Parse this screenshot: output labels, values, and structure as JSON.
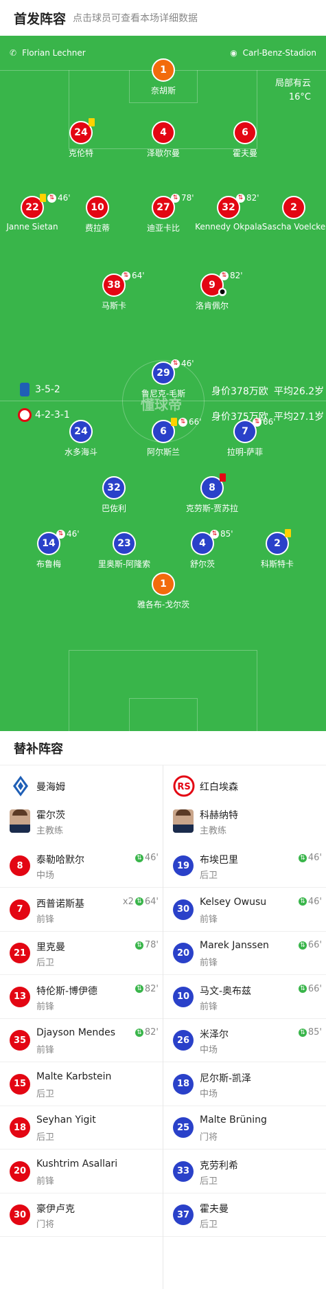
{
  "header": {
    "title": "首发阵容",
    "subtitle": "点击球员可查看本场详细数据"
  },
  "match_info": {
    "referee": "Florian Lechner",
    "stadium": "Carl-Benz-Stadion",
    "weather": "局部有云",
    "temperature": "16°C"
  },
  "watermark": "懂球帝",
  "teams": {
    "home": {
      "formation": "3-5-2",
      "value": "身价378万欧",
      "avg_age": "平均26.2岁"
    },
    "away": {
      "formation": "4-2-3-1",
      "value": "身价375万欧",
      "avg_age": "平均27.1岁"
    }
  },
  "home_lineup": [
    {
      "num": "1",
      "name": "奈胡斯",
      "pos": "gk",
      "ev": ""
    },
    {
      "num": "24",
      "name": "克伦特",
      "ev": "",
      "yellow": true
    },
    {
      "num": "4",
      "name": "泽歇尔曼",
      "ev": ""
    },
    {
      "num": "6",
      "name": "霍夫曼",
      "ev": ""
    },
    {
      "num": "22",
      "name": "Janne Sietan",
      "ev": "46'",
      "yellow": true,
      "sub": true
    },
    {
      "num": "10",
      "name": "费拉蒂",
      "ev": ""
    },
    {
      "num": "27",
      "name": "迪亚卡比",
      "ev": "78'",
      "sub": true
    },
    {
      "num": "32",
      "name": "Kennedy Okpala",
      "ev": "82'",
      "sub": true
    },
    {
      "num": "2",
      "name": "Sascha Voelcke",
      "ev": ""
    },
    {
      "num": "38",
      "name": "马斯卡",
      "ev": "64'",
      "sub": true
    },
    {
      "num": "9",
      "name": "洛肯佩尔",
      "ev": "82'",
      "sub": true,
      "goal": true
    }
  ],
  "away_lineup": [
    {
      "num": "29",
      "name": "鲁尼克-毛斯",
      "ev": "46'",
      "sub": true
    },
    {
      "num": "24",
      "name": "水多海斗",
      "ev": ""
    },
    {
      "num": "6",
      "name": "阿尔斯兰",
      "ev": "66'",
      "yellow": true,
      "sub": true
    },
    {
      "num": "7",
      "name": "拉明-萨菲",
      "ev": "66'",
      "sub": true
    },
    {
      "num": "32",
      "name": "巴佐利",
      "ev": ""
    },
    {
      "num": "8",
      "name": "克劳斯-贾苏拉",
      "ev": "",
      "red": true
    },
    {
      "num": "14",
      "name": "布鲁梅",
      "ev": "46'",
      "sub": true
    },
    {
      "num": "23",
      "name": "里奥斯-阿隆索",
      "ev": ""
    },
    {
      "num": "4",
      "name": "舒尔茨",
      "ev": "85'",
      "sub": true
    },
    {
      "num": "2",
      "name": "科斯特卡",
      "ev": "",
      "yellow": true
    },
    {
      "num": "1",
      "name": "雅各布-戈尔茨",
      "pos": "gk",
      "ev": ""
    }
  ],
  "subs_title": "替补阵容",
  "home_team": {
    "name": "曼海姆",
    "coach": "霍尔茨",
    "coach_role": "主教练"
  },
  "away_team": {
    "name": "红白埃森",
    "coach": "科赫纳特",
    "coach_role": "主教练"
  },
  "home_subs": [
    {
      "num": "8",
      "name": "泰勒哈默尔",
      "pos": "中场",
      "ev": "46'"
    },
    {
      "num": "7",
      "name": "西普诺斯基",
      "pos": "前锋",
      "ev": "64'",
      "extra": "x2"
    },
    {
      "num": "21",
      "name": "里克曼",
      "pos": "后卫",
      "ev": "78'"
    },
    {
      "num": "13",
      "name": "特伦斯-博伊德",
      "pos": "前锋",
      "ev": "82'"
    },
    {
      "num": "35",
      "name": "Djayson Mendes",
      "pos": "前锋",
      "ev": "82'"
    },
    {
      "num": "15",
      "name": "Malte Karbstein",
      "pos": "后卫",
      "ev": ""
    },
    {
      "num": "18",
      "name": "Seyhan Yigit",
      "pos": "后卫",
      "ev": ""
    },
    {
      "num": "20",
      "name": "Kushtrim Asallari",
      "pos": "前锋",
      "ev": ""
    },
    {
      "num": "30",
      "name": "豪伊卢克",
      "pos": "门将",
      "ev": ""
    }
  ],
  "away_subs": [
    {
      "num": "19",
      "name": "布埃巴里",
      "pos": "后卫",
      "ev": "46'"
    },
    {
      "num": "30",
      "name": "Kelsey Owusu",
      "pos": "前锋",
      "ev": "46'"
    },
    {
      "num": "20",
      "name": "Marek Janssen",
      "pos": "前锋",
      "ev": "66'"
    },
    {
      "num": "10",
      "name": "马文-奥布兹",
      "pos": "前锋",
      "ev": "66'"
    },
    {
      "num": "26",
      "name": "米泽尔",
      "pos": "中场",
      "ev": "85'"
    },
    {
      "num": "18",
      "name": "尼尔斯-凯泽",
      "pos": "中场",
      "ev": ""
    },
    {
      "num": "25",
      "name": "Malte Brüning",
      "pos": "门将",
      "ev": ""
    },
    {
      "num": "33",
      "name": "克劳利希",
      "pos": "后卫",
      "ev": ""
    },
    {
      "num": "37",
      "name": "霍夫曼",
      "pos": "后卫",
      "ev": ""
    }
  ]
}
